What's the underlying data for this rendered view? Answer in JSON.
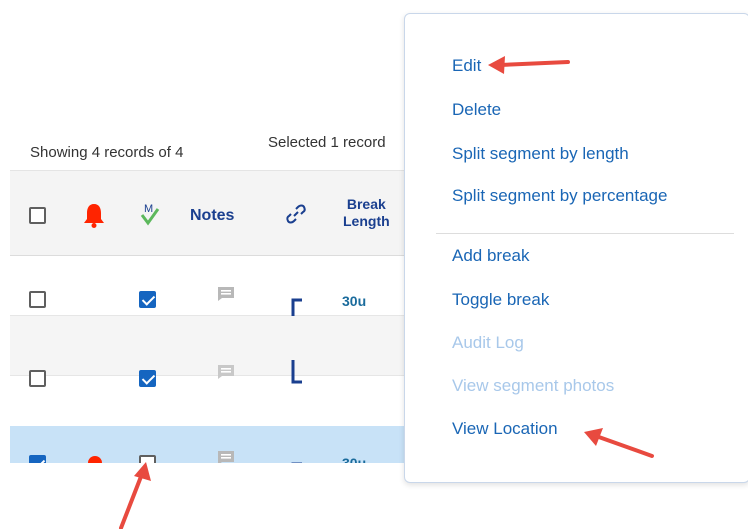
{
  "info": {
    "showing": "Showing 4 records of 4",
    "selected": "Selected 1 record"
  },
  "grid": {
    "header": {
      "notes": "Notes",
      "break_length_line1": "Break",
      "break_length_line2": "Length"
    },
    "rows": [
      {
        "checked": false,
        "flag_checked": true,
        "break_length": "30u"
      },
      {
        "checked": false,
        "flag_checked": true,
        "break_length": ""
      },
      {
        "checked": true,
        "flag_checked": false,
        "break_length": "30u"
      }
    ]
  },
  "menu": {
    "items": [
      {
        "label": "Edit",
        "enabled": true
      },
      {
        "label": "Delete",
        "enabled": true
      },
      {
        "label": "Split segment by length",
        "enabled": true
      },
      {
        "label": "Split segment by percentage",
        "enabled": true
      },
      {
        "label": "Add break",
        "enabled": true
      },
      {
        "label": "Toggle break",
        "enabled": true
      },
      {
        "label": "Audit Log",
        "enabled": false
      },
      {
        "label": "View segment photos",
        "enabled": false
      },
      {
        "label": "View Location",
        "enabled": true
      }
    ]
  },
  "colors": {
    "accent": "#1a66b5",
    "disabled": "#a8c8ea",
    "selected_row": "#c8e2f7",
    "alert": "#ff2400",
    "annotation_arrow": "#e84a3f"
  }
}
